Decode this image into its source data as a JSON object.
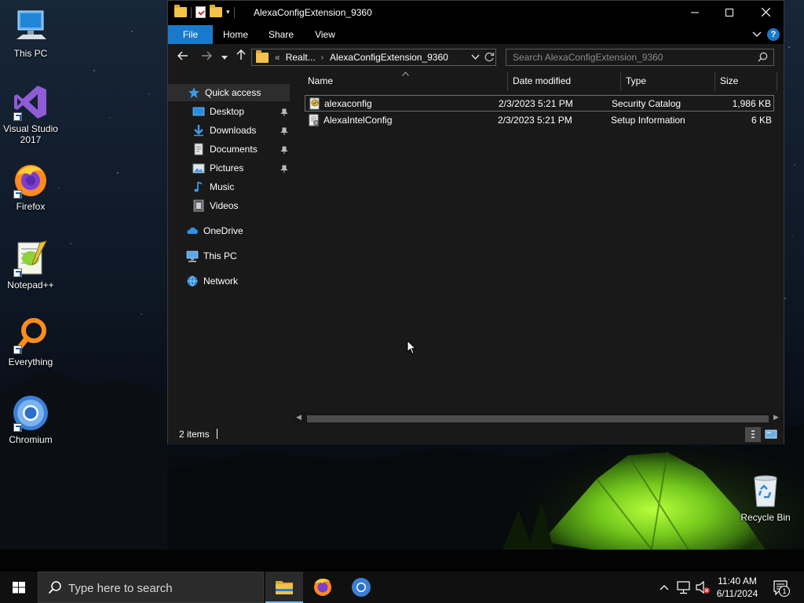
{
  "desktop": {
    "icons": [
      {
        "label": "This PC"
      },
      {
        "label": "Visual Studio 2017"
      },
      {
        "label": "Firefox"
      },
      {
        "label": "Notepad++"
      },
      {
        "label": "Everything"
      },
      {
        "label": "Chromium"
      },
      {
        "label": "Recycle Bin"
      }
    ]
  },
  "window": {
    "title": "AlexaConfigExtension_9360",
    "ribbon_tabs": [
      "File",
      "Home",
      "Share",
      "View"
    ],
    "address": {
      "prefix": "«",
      "crumbs": [
        "Realt...",
        "AlexaConfigExtension_9360"
      ]
    },
    "search_placeholder": "Search AlexaConfigExtension_9360",
    "nav": {
      "quick_access": "Quick access",
      "items": [
        "Desktop",
        "Downloads",
        "Documents",
        "Pictures",
        "Music",
        "Videos"
      ],
      "onedrive": "OneDrive",
      "this_pc": "This PC",
      "network": "Network"
    },
    "columns": [
      "Name",
      "Date modified",
      "Type",
      "Size"
    ],
    "files": [
      {
        "name": "alexaconfig",
        "date": "2/3/2023 5:21 PM",
        "type": "Security Catalog",
        "size": "1,986 KB"
      },
      {
        "name": "AlexaIntelConfig",
        "date": "2/3/2023 5:21 PM",
        "type": "Setup Information",
        "size": "6 KB"
      }
    ],
    "status": "2 items"
  },
  "taskbar": {
    "search_placeholder": "Type here to search",
    "time": "11:40 AM",
    "date": "6/11/2024",
    "notification_count": "1"
  },
  "colors": {
    "accent": "#1979ca",
    "folder": "#f3c24a",
    "window_bg": "#191919"
  }
}
